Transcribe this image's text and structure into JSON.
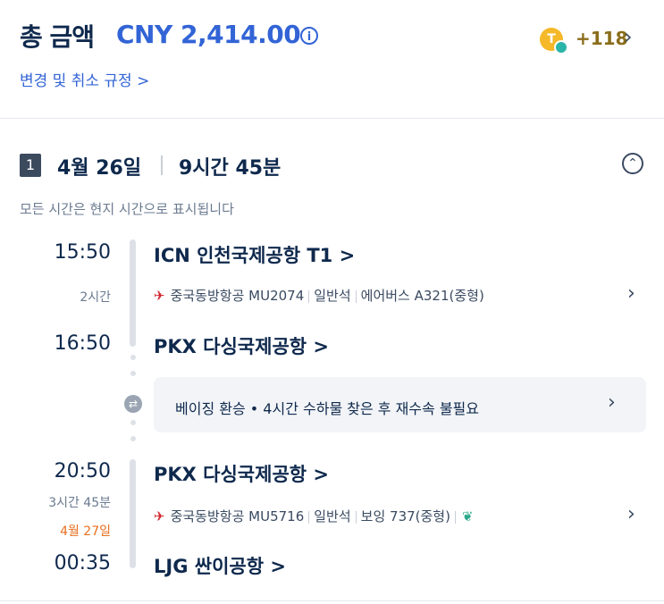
{
  "header": {
    "title": "총 금액",
    "price": "CNY 2,414.00",
    "coin_letter": "T",
    "points": "+118",
    "policy_link": "변경 및 취소 규정 >"
  },
  "segment": {
    "number": "1",
    "date": "4월 26일",
    "duration": "9시간 45분",
    "note": "모든 시간은 현지 시간으로 표시됩니다",
    "legs": [
      {
        "dep_time": "15:50",
        "dep_airport": "ICN 인천국제공항 T1 >",
        "duration": "2시간",
        "airline": "중국동방항공 MU2074",
        "cabin": "일반석",
        "aircraft": "에어버스 A321(중형)",
        "arr_time": "16:50",
        "arr_airport": "PKX 다싱국제공항 >"
      },
      {
        "dep_time": "20:50",
        "dep_airport": "PKX 다싱국제공항 >",
        "duration": "3시간 45분",
        "next_day": "4월 27일",
        "airline": "중국동방항공 MU5716",
        "cabin": "일반석",
        "aircraft": "보잉 737(중형)",
        "arr_time": "00:35",
        "arr_airport": "LJG 싼이공항 >"
      }
    ],
    "transfer": "베이징 환승 • 4시간 수하물 찾은 후 재수속 불필요"
  },
  "icons": {
    "info": "i",
    "chevron": "›",
    "collapse": "⌃",
    "airline_logo": "✈",
    "leaf": "❦",
    "transfer": "⇄"
  },
  "colors": {
    "accent": "#3264d6",
    "next_day": "#e86f1f",
    "coin": "#f5b829"
  }
}
